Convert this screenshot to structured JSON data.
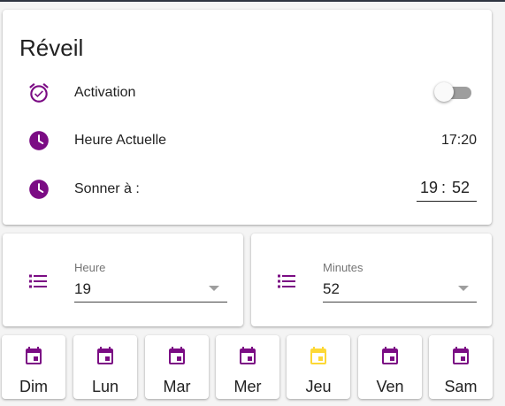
{
  "colors": {
    "accent": "#7b0c84",
    "today": "#fdd835",
    "toggle_off": "#9e9e9e"
  },
  "alarm": {
    "title": "Réveil",
    "activation": {
      "label": "Activation",
      "icon": "alarm-check-icon",
      "enabled": false
    },
    "current_time": {
      "label": "Heure Actuelle",
      "value": "17:20",
      "icon": "clock-icon"
    },
    "ring_at": {
      "label": "Sonner à :",
      "hour": "19",
      "separator": ":",
      "minute": "52",
      "icon": "clock-icon"
    }
  },
  "selects": {
    "hour": {
      "label": "Heure",
      "value": "19",
      "icon": "list-icon"
    },
    "minutes": {
      "label": "Minutes",
      "value": "52",
      "icon": "list-icon"
    }
  },
  "days": [
    {
      "label": "Dim",
      "icon": "calendar-icon",
      "active": false
    },
    {
      "label": "Lun",
      "icon": "calendar-icon",
      "active": false
    },
    {
      "label": "Mar",
      "icon": "calendar-icon",
      "active": false
    },
    {
      "label": "Mer",
      "icon": "calendar-icon",
      "active": false
    },
    {
      "label": "Jeu",
      "icon": "calendar-icon",
      "active": true
    },
    {
      "label": "Ven",
      "icon": "calendar-icon",
      "active": false
    },
    {
      "label": "Sam",
      "icon": "calendar-icon",
      "active": false
    }
  ]
}
